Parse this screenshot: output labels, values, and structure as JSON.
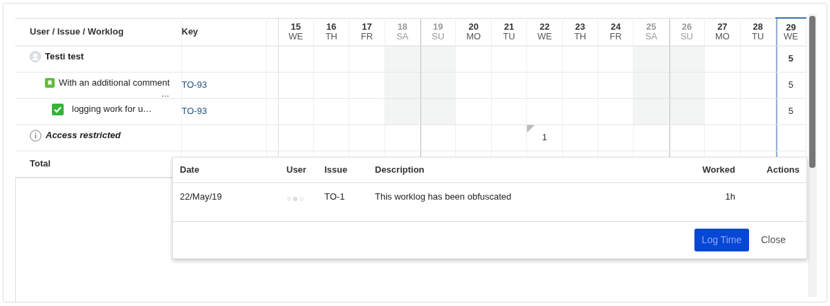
{
  "table": {
    "columns": [
      "User / Issue / Worklog",
      "Key"
    ],
    "days": [
      {
        "day": "15",
        "weekday": "WE",
        "weekend": false,
        "week_start": false,
        "today": false
      },
      {
        "day": "16",
        "weekday": "TH",
        "weekend": false,
        "week_start": false,
        "today": false
      },
      {
        "day": "17",
        "weekday": "FR",
        "weekend": false,
        "week_start": false,
        "today": false
      },
      {
        "day": "18",
        "weekday": "SA",
        "weekend": true,
        "week_start": false,
        "today": false
      },
      {
        "day": "19",
        "weekday": "SU",
        "weekend": true,
        "week_start": true,
        "today": false
      },
      {
        "day": "20",
        "weekday": "MO",
        "weekend": false,
        "week_start": false,
        "today": false
      },
      {
        "day": "21",
        "weekday": "TU",
        "weekend": false,
        "week_start": false,
        "today": false
      },
      {
        "day": "22",
        "weekday": "WE",
        "weekend": false,
        "week_start": false,
        "today": false
      },
      {
        "day": "23",
        "weekday": "TH",
        "weekend": false,
        "week_start": false,
        "today": false
      },
      {
        "day": "24",
        "weekday": "FR",
        "weekend": false,
        "week_start": false,
        "today": false
      },
      {
        "day": "25",
        "weekday": "SA",
        "weekend": true,
        "week_start": false,
        "today": false
      },
      {
        "day": "26",
        "weekday": "SU",
        "weekend": true,
        "week_start": true,
        "today": false
      },
      {
        "day": "27",
        "weekday": "MO",
        "weekend": false,
        "week_start": false,
        "today": false
      },
      {
        "day": "28",
        "weekday": "TU",
        "weekend": false,
        "week_start": false,
        "today": false
      },
      {
        "day": "29",
        "weekday": "WE",
        "weekend": false,
        "week_start": false,
        "today": true
      }
    ],
    "rows": [
      {
        "kind": "user",
        "label": "Testi test",
        "cells": [
          {},
          {},
          {},
          {},
          {},
          {},
          {},
          {},
          {},
          {},
          {},
          {},
          {},
          {},
          {
            "value": "5"
          }
        ]
      },
      {
        "kind": "issue",
        "label": "With an additional comment",
        "more": "…",
        "key": "TO-93",
        "cells": [
          {},
          {},
          {},
          {},
          {},
          {},
          {},
          {},
          {},
          {},
          {},
          {},
          {},
          {},
          {
            "value": "5"
          }
        ]
      },
      {
        "kind": "worklog",
        "label": "logging work for u…",
        "key": "TO-93",
        "cells": [
          {},
          {},
          {},
          {},
          {},
          {},
          {},
          {},
          {},
          {},
          {},
          {},
          {},
          {},
          {
            "value": "5"
          }
        ]
      },
      {
        "kind": "restricted",
        "label": "Access restricted",
        "cells": [
          {},
          {},
          {},
          {},
          {},
          {},
          {},
          {
            "value": "1",
            "flagged": true
          },
          {},
          {},
          {},
          {},
          {},
          {},
          {}
        ]
      }
    ],
    "total_label": "Total"
  },
  "popup": {
    "columns": [
      "Date",
      "User",
      "Issue",
      "Description",
      "Worked",
      "Actions"
    ],
    "rows": [
      {
        "date": "22/May/19",
        "issue": "TO-1",
        "description": "This worklog has been obfuscated",
        "worked": "1h"
      }
    ],
    "buttons": [
      {
        "label": "Log Time",
        "kind": "primary"
      },
      {
        "label": "Close",
        "kind": "link"
      }
    ]
  }
}
